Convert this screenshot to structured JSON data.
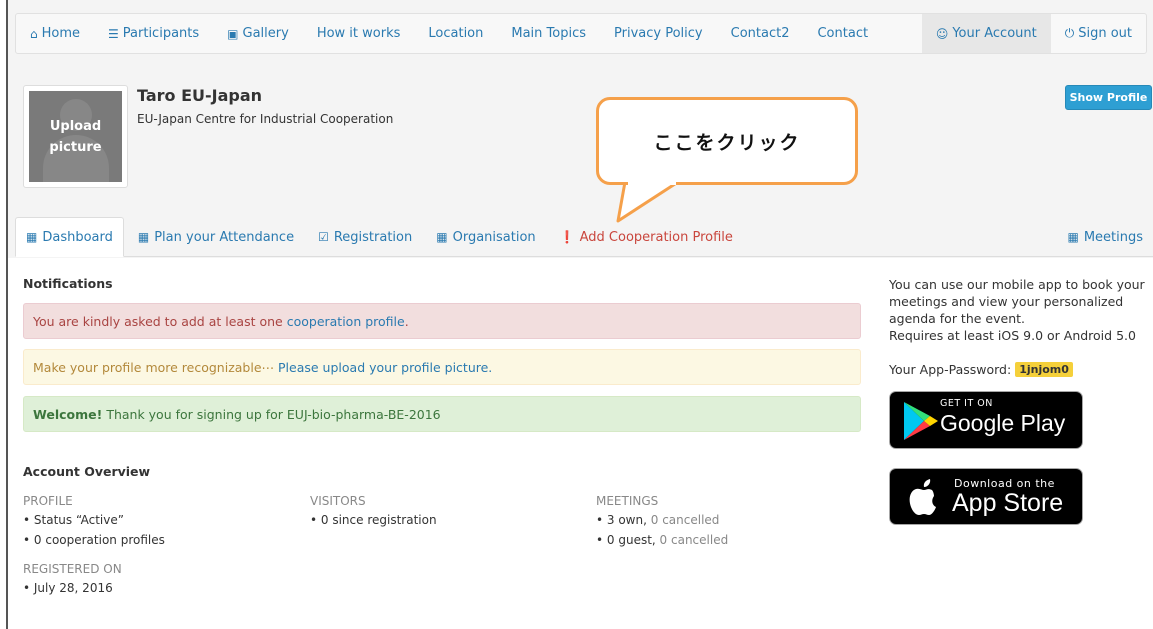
{
  "nav": {
    "left": [
      {
        "icon": "home-icon",
        "glyph": "⌂",
        "label": "Home"
      },
      {
        "icon": "list-icon",
        "glyph": "☰",
        "label": "Participants"
      },
      {
        "icon": "picture-icon",
        "glyph": "▣",
        "label": "Gallery"
      },
      {
        "label": "How it works"
      },
      {
        "label": "Location"
      },
      {
        "label": "Main Topics"
      },
      {
        "label": "Privacy Policy"
      },
      {
        "label": "Contact2"
      },
      {
        "label": "Contact"
      }
    ],
    "right": [
      {
        "icon": "user-icon",
        "glyph": "☺",
        "label": "Your Account"
      },
      {
        "icon": "power-icon",
        "glyph": "⏻",
        "label": "Sign out"
      }
    ]
  },
  "profile": {
    "upload_label": "Upload picture",
    "name": "Taro EU-Japan",
    "organisation": "EU-Japan Centre for Industrial Cooperation",
    "show_profile": "Show Profile"
  },
  "callout": {
    "text": "ここをクリック",
    "border_color": "#f5a04a"
  },
  "tabs": {
    "dashboard": "Dashboard",
    "plan": "Plan your Attendance",
    "registration": "Registration",
    "organisation": "Organisation",
    "add_coop": "Add Cooperation Profile",
    "meetings": "Meetings"
  },
  "notifications": {
    "title": "Notifications",
    "danger_text": "You are kindly asked to add at least one",
    "danger_link": "cooperation profile",
    "danger_end": ".",
    "warning_text": "Make your profile more recognizable⋯",
    "warning_link": "Please upload your profile picture.",
    "success_bold": "Welcome!",
    "success_text": "Thank you for signing up for EUJ-bio-pharma-BE-2016"
  },
  "overview": {
    "title": "Account Overview",
    "profile_head": "PROFILE",
    "profile_status": "• Status “Active”",
    "profile_coop": "• 0 cooperation profiles",
    "visitors_head": "VISITORS",
    "visitors_line": "• 0 since registration",
    "meetings_head": "MEETINGS",
    "meetings_own": "• 3 own,",
    "meetings_own_cancel": "0 cancelled",
    "meetings_guest": "• 0 guest,",
    "meetings_guest_cancel": "0 cancelled",
    "registered_head": "REGISTERED ON",
    "registered_date": "• July 28, 2016"
  },
  "app": {
    "text_1": "You can use our mobile app to book your meetings and view your personalized agenda for the event.",
    "text_2": "Requires at least iOS 9.0 or Android 5.0",
    "password_label": "Your App-Password:",
    "password_value": "1jnjom0",
    "gplay_small": "GET IT ON",
    "gplay_big": "Google Play",
    "appstore_small": "Download on the",
    "appstore_big": "App Store"
  },
  "colors": {
    "link": "#2a7ab0",
    "warn": "#c9463d",
    "accent_button": "#2e9fd3",
    "badge": "#f5d03a"
  }
}
